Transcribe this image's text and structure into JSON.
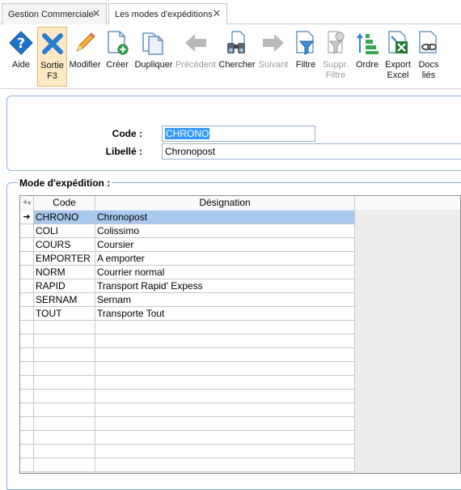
{
  "tabs": [
    {
      "label": "Gestion Commerciale",
      "close": "✕"
    },
    {
      "label": "Les modes d'expéditions",
      "close": "✕"
    }
  ],
  "toolbar": {
    "aide": "Aide",
    "sortie_1": "Sortie",
    "sortie_2": "F3",
    "modifier": "Modifier",
    "creer": "Créer",
    "dupliquer": "Dupliquer",
    "precedent": "Précédent",
    "chercher": "Chercher",
    "suivant": "Suivant",
    "filtre": "Filtre",
    "suppr_1": "Suppr.",
    "suppr_2": "Filtre",
    "ordre": "Ordre",
    "export_1": "Export",
    "export_2": "Excel",
    "docs_1": "Docs",
    "docs_2": "liés"
  },
  "form": {
    "code_label": "Code :",
    "code_value": "CHRONO",
    "libelle_label": "Libellé :",
    "libelle_value": "Chronopost"
  },
  "group_title": "Mode d'expédition :",
  "grid": {
    "add_symbol": "+",
    "columns": [
      "Code",
      "Désignation"
    ],
    "current_row_marker": "➔",
    "rows": [
      {
        "code": "CHRONO",
        "designation": "Chronopost"
      },
      {
        "code": "COLI",
        "designation": "Colissimo"
      },
      {
        "code": "COURS",
        "designation": "Coursier"
      },
      {
        "code": "EMPORTER",
        "designation": "A emporter"
      },
      {
        "code": "NORM",
        "designation": "Courrier normal"
      },
      {
        "code": "RAPID",
        "designation": "Transport Rapid' Expess"
      },
      {
        "code": "SERNAM",
        "designation": "Sernam"
      },
      {
        "code": "TOUT",
        "designation": "Transporte Tout"
      }
    ]
  },
  "colors": {
    "accent_blue": "#1f7bd6",
    "selection": "#a9c8ed",
    "text_highlight": "#3399ff"
  }
}
